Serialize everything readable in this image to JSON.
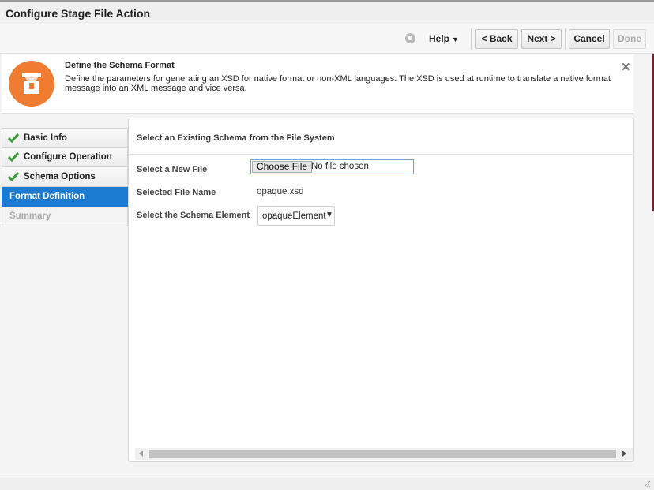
{
  "window": {
    "title": "Configure Stage File Action"
  },
  "toolbar": {
    "help_label": "Help",
    "back_label": "< Back",
    "next_label": "Next >",
    "cancel_label": "Cancel",
    "done_label": "Done"
  },
  "info": {
    "title": "Define the Schema Format",
    "text": "Define the parameters for generating an XSD for native format or non-XML languages. The XSD is used at runtime to translate a native format message into an XML message and vice versa."
  },
  "nav": {
    "items": [
      {
        "label": "Basic Info",
        "state": "complete"
      },
      {
        "label": "Configure Operation",
        "state": "complete"
      },
      {
        "label": "Schema Options",
        "state": "complete"
      },
      {
        "label": "Format Definition",
        "state": "active"
      },
      {
        "label": "Summary",
        "state": "disabled"
      }
    ]
  },
  "main": {
    "heading": "Select an Existing Schema from the File System",
    "new_file_label": "Select a New File",
    "choose_file_label": "Choose File",
    "no_file_text": "No file chosen",
    "selected_file_label": "Selected File Name",
    "selected_file_value": "opaque.xsd",
    "schema_element_label": "Select the Schema Element",
    "schema_element_value": "opaqueElement"
  },
  "colors": {
    "accent": "#1a7bd0",
    "icon_orange": "#f07c32",
    "check_green": "#3a9a3a"
  }
}
